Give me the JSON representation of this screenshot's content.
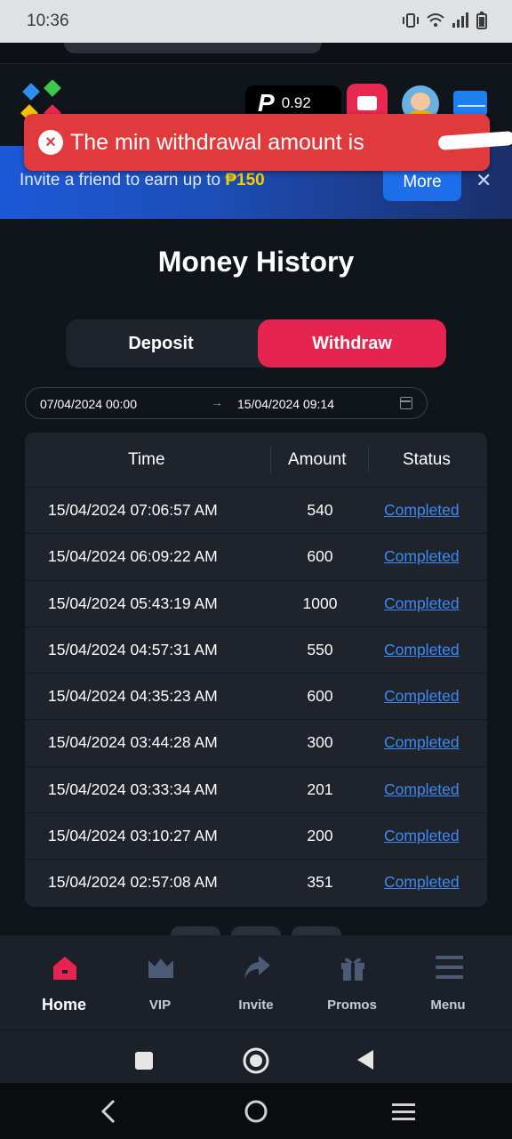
{
  "status_bar": {
    "time": "10:36"
  },
  "header": {
    "balance": "0.92",
    "balance_coin": "P"
  },
  "toast": {
    "message": "The min withdrawal amount is",
    "icon": "error-x-icon"
  },
  "banner": {
    "text": "Invite a friend to earn up to",
    "coin": "₱",
    "amount": "150",
    "more_label": "More",
    "close": "✕"
  },
  "page": {
    "title": "Money History"
  },
  "tabs": [
    {
      "label": "Deposit",
      "active": false
    },
    {
      "label": "Withdraw",
      "active": true
    }
  ],
  "date_range": {
    "from": "07/04/2024 00:00",
    "to": "15/04/2024 09:14",
    "arrow": "→"
  },
  "table": {
    "headers": {
      "time": "Time",
      "amount": "Amount",
      "status": "Status"
    },
    "rows": [
      {
        "time": "15/04/2024 07:06:57 AM",
        "amount": "540",
        "status": "Completed"
      },
      {
        "time": "15/04/2024 06:09:22 AM",
        "amount": "600",
        "status": "Completed"
      },
      {
        "time": "15/04/2024 05:43:19 AM",
        "amount": "1000",
        "status": "Completed"
      },
      {
        "time": "15/04/2024 04:57:31 AM",
        "amount": "550",
        "status": "Completed"
      },
      {
        "time": "15/04/2024 04:35:23 AM",
        "amount": "600",
        "status": "Completed"
      },
      {
        "time": "15/04/2024 03:44:28 AM",
        "amount": "300",
        "status": "Completed"
      },
      {
        "time": "15/04/2024 03:33:34 AM",
        "amount": "201",
        "status": "Completed"
      },
      {
        "time": "15/04/2024 03:10:27 AM",
        "amount": "200",
        "status": "Completed"
      },
      {
        "time": "15/04/2024 02:57:08 AM",
        "amount": "351",
        "status": "Completed"
      }
    ]
  },
  "bottom_nav": [
    {
      "label": "Home",
      "icon": "home-icon",
      "active": true
    },
    {
      "label": "VIP",
      "icon": "crown-icon",
      "active": false
    },
    {
      "label": "Invite",
      "icon": "share-arrow-icon",
      "active": false
    },
    {
      "label": "Promos",
      "icon": "gift-icon",
      "active": false
    },
    {
      "label": "Menu",
      "icon": "menu-icon",
      "active": false
    }
  ],
  "colors": {
    "accent": "#e5254f",
    "link": "#3d8bf2",
    "toast": "#e13a3c",
    "banner": "#1c59d8",
    "background": "#10141b"
  }
}
